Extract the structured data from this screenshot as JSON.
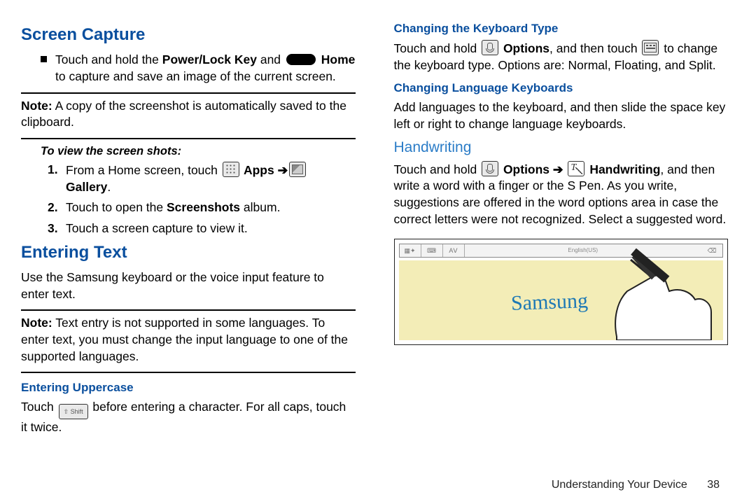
{
  "left": {
    "h_screen_capture": "Screen Capture",
    "bullet1_pre": "Touch and hold the ",
    "bullet1_b1": "Power/Lock Key",
    "bullet1_mid": " and ",
    "bullet1_b2": " Home",
    "bullet1_line2": "to capture and save an image of the current screen.",
    "note1_b": "Note:",
    "note1_t": " A copy of the screenshot is automatically saved to the clipboard.",
    "sublabel": "To view the screen shots:",
    "s1_pre": "From a Home screen, touch ",
    "s1_apps": " Apps ",
    "s1_arrow": "➔",
    "s1_gal": " Gallery",
    "s1_end": ".",
    "s2_pre": "Touch to open the ",
    "s2_b": "Screenshots",
    "s2_end": " album.",
    "s3": "Touch a screen capture to view it.",
    "h_entering_text": "Entering Text",
    "et_p": "Use the Samsung keyboard or the voice input feature to enter text.",
    "note2_b": "Note:",
    "note2_t": " Text entry is not supported in some languages. To enter text, you must change the input language to one of the supported languages.",
    "h_upper": "Entering Uppercase",
    "upper_pre": "Touch ",
    "upper_post": " before entering a character. For all caps, touch it twice."
  },
  "right": {
    "h_kbd": "Changing the Keyboard Type",
    "kbd_pre": "Touch and hold ",
    "kbd_opt": " Options",
    "kbd_mid": ", and then touch ",
    "kbd_post": " to change the keyboard type. Options are: Normal, Floating, and Split.",
    "h_lang": "Changing Language Keyboards",
    "lang_p": "Add languages to the keyboard, and then slide the space key left or right to change language keyboards.",
    "h_hw": "Handwriting",
    "hw_pre": "Touch and hold ",
    "hw_opt": " Options ",
    "hw_arrow": "➔",
    "hw_hw": " Handwriting",
    "hw_post": ", and then write a word with a finger or the S Pen. As you write, suggestions are offered in the word options area in case the correct letters were not recognized. Select a suggested word.",
    "hw_word": "Samsung",
    "tb_lang": "English(US)"
  },
  "footer": {
    "section": "Understanding Your Device",
    "page": "38"
  }
}
